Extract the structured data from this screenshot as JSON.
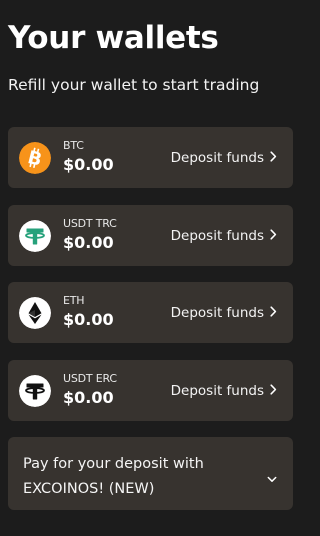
{
  "page": {
    "title": "Your wallets",
    "subtitle": "Refill your wallet to start trading"
  },
  "wallets": [
    {
      "name": "BTC",
      "balance": "$0.00",
      "action": "Deposit funds",
      "icon": "bitcoin-icon",
      "color": "#f7931a"
    },
    {
      "name": "USDT TRC",
      "balance": "$0.00",
      "action": "Deposit funds",
      "icon": "tether-icon",
      "color": "#26a17b"
    },
    {
      "name": "ETH",
      "balance": "$0.00",
      "action": "Deposit funds",
      "icon": "ethereum-icon",
      "color": "#ffffff"
    },
    {
      "name": "USDT ERC",
      "balance": "$0.00",
      "action": "Deposit funds",
      "icon": "tether-icon",
      "color": "#ffffff"
    }
  ],
  "promo": {
    "text": "Pay for your deposit with EXCOINOS! (NEW)",
    "icon": "chevron-down-icon"
  },
  "theme": {
    "background": "#1c1c1c",
    "card": "#37332f"
  }
}
